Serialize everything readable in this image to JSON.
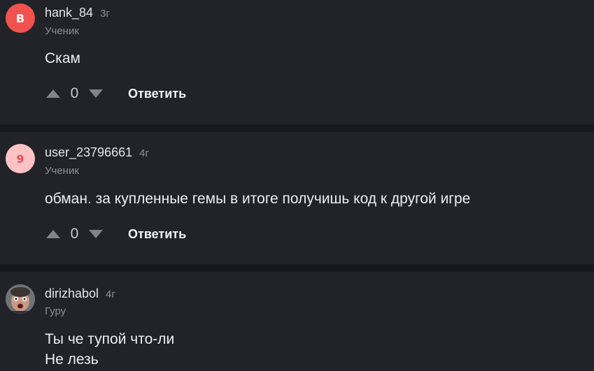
{
  "comments": [
    {
      "username": "hank_84",
      "time": "3г",
      "rank": "Ученик",
      "avatar_letter": "B",
      "lines": [
        "Скам"
      ],
      "score": "0",
      "reply_label": "Ответить"
    },
    {
      "username": "user_23796661",
      "time": "4г",
      "rank": "Ученик",
      "avatar_letter": "9",
      "lines": [
        "обман. за купленные гемы в итоге получишь код к другой игре"
      ],
      "score": "0",
      "reply_label": "Ответить"
    },
    {
      "username": "dirizhabol",
      "time": "4г",
      "rank": "Гуру",
      "avatar_letter": "",
      "lines": [
        "Ты че тупой что-ли",
        "Не лезь"
      ]
    }
  ],
  "colors": {
    "background": "#17191e",
    "card": "#212329",
    "avatar_red": "#f0524f",
    "avatar_pink": "#ffc2c4",
    "muted_text": "#8c9097",
    "vote_arrow": "#80848b"
  },
  "icons": {
    "upvote": "triangle-up-icon",
    "downvote": "triangle-down-icon",
    "photo_avatar": "user-photo-avatar"
  }
}
